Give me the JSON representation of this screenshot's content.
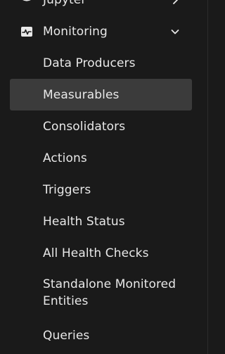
{
  "nav": {
    "jupyter": {
      "label": "Jupyter"
    },
    "monitoring": {
      "label": "Monitoring",
      "expanded": true,
      "children": [
        {
          "label": "Data Producers"
        },
        {
          "label": "Measurables",
          "active": true
        },
        {
          "label": "Consolidators"
        },
        {
          "label": "Actions"
        },
        {
          "label": "Triggers"
        },
        {
          "label": "Health Status"
        },
        {
          "label": "All Health Checks"
        },
        {
          "label": "Standalone Monitored Entities"
        },
        {
          "label": "Queries"
        }
      ]
    }
  },
  "colors": {
    "background": "#1a1a1a",
    "active_item": "#3b3b3b",
    "text": "#e8e8e8"
  }
}
